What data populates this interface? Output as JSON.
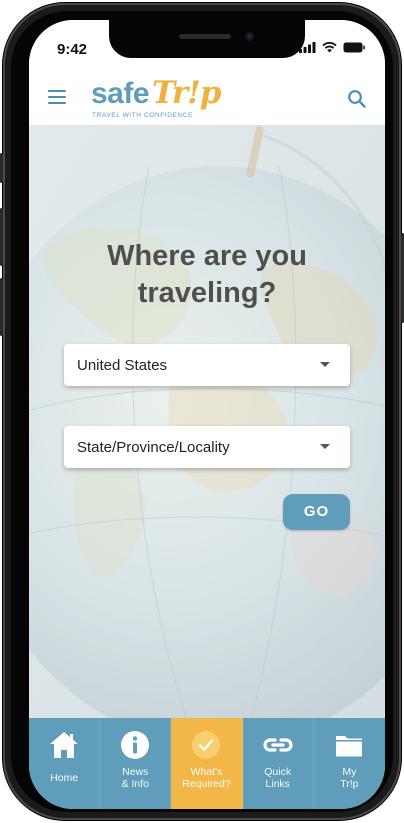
{
  "status_bar": {
    "time": "9:42"
  },
  "header": {
    "logo_safe": "safe",
    "logo_trip": "Tr!p",
    "logo_tagline": "TRAVEL WITH CONFIDENCE"
  },
  "hero": {
    "title_line1": "Where are you",
    "title_line2": "traveling?",
    "country_select": {
      "value": "United States"
    },
    "region_select": {
      "value": "State/Province/Locality"
    },
    "go_label": "GO"
  },
  "bottom_nav": {
    "items": [
      {
        "label": "Home",
        "icon": "home-icon"
      },
      {
        "label_line1": "News",
        "label_line2": "& Info",
        "icon": "info-icon"
      },
      {
        "label_line1": "What's",
        "label_line2": "Required?",
        "icon": "check-circle-icon",
        "active": true
      },
      {
        "label_line1": "Quick",
        "label_line2": "Links",
        "icon": "link-icon"
      },
      {
        "label_line1": "My",
        "label_line2": "Tr!p",
        "icon": "folder-icon"
      }
    ]
  },
  "colors": {
    "brand_blue": "#5f9dbb",
    "brand_orange": "#f2b746",
    "title_gray": "#4f4f4f"
  }
}
